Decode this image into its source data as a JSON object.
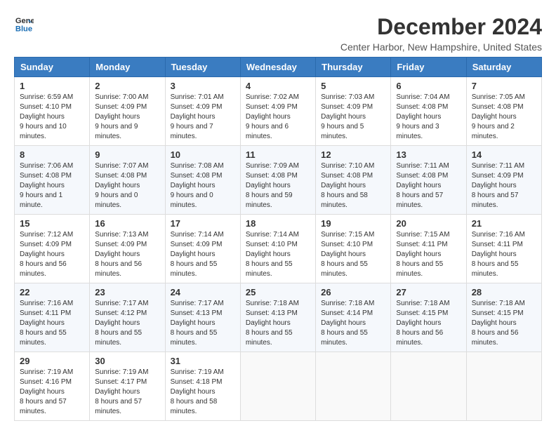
{
  "logo": {
    "line1": "General",
    "line2": "Blue"
  },
  "title": "December 2024",
  "subtitle": "Center Harbor, New Hampshire, United States",
  "days": [
    "Sunday",
    "Monday",
    "Tuesday",
    "Wednesday",
    "Thursday",
    "Friday",
    "Saturday"
  ],
  "weeks": [
    [
      {
        "day": 1,
        "sunrise": "6:59 AM",
        "sunset": "4:10 PM",
        "daylight": "9 hours and 10 minutes."
      },
      {
        "day": 2,
        "sunrise": "7:00 AM",
        "sunset": "4:09 PM",
        "daylight": "9 hours and 9 minutes."
      },
      {
        "day": 3,
        "sunrise": "7:01 AM",
        "sunset": "4:09 PM",
        "daylight": "9 hours and 7 minutes."
      },
      {
        "day": 4,
        "sunrise": "7:02 AM",
        "sunset": "4:09 PM",
        "daylight": "9 hours and 6 minutes."
      },
      {
        "day": 5,
        "sunrise": "7:03 AM",
        "sunset": "4:09 PM",
        "daylight": "9 hours and 5 minutes."
      },
      {
        "day": 6,
        "sunrise": "7:04 AM",
        "sunset": "4:08 PM",
        "daylight": "9 hours and 3 minutes."
      },
      {
        "day": 7,
        "sunrise": "7:05 AM",
        "sunset": "4:08 PM",
        "daylight": "9 hours and 2 minutes."
      }
    ],
    [
      {
        "day": 8,
        "sunrise": "7:06 AM",
        "sunset": "4:08 PM",
        "daylight": "9 hours and 1 minute."
      },
      {
        "day": 9,
        "sunrise": "7:07 AM",
        "sunset": "4:08 PM",
        "daylight": "9 hours and 0 minutes."
      },
      {
        "day": 10,
        "sunrise": "7:08 AM",
        "sunset": "4:08 PM",
        "daylight": "9 hours and 0 minutes."
      },
      {
        "day": 11,
        "sunrise": "7:09 AM",
        "sunset": "4:08 PM",
        "daylight": "8 hours and 59 minutes."
      },
      {
        "day": 12,
        "sunrise": "7:10 AM",
        "sunset": "4:08 PM",
        "daylight": "8 hours and 58 minutes."
      },
      {
        "day": 13,
        "sunrise": "7:11 AM",
        "sunset": "4:08 PM",
        "daylight": "8 hours and 57 minutes."
      },
      {
        "day": 14,
        "sunrise": "7:11 AM",
        "sunset": "4:09 PM",
        "daylight": "8 hours and 57 minutes."
      }
    ],
    [
      {
        "day": 15,
        "sunrise": "7:12 AM",
        "sunset": "4:09 PM",
        "daylight": "8 hours and 56 minutes."
      },
      {
        "day": 16,
        "sunrise": "7:13 AM",
        "sunset": "4:09 PM",
        "daylight": "8 hours and 56 minutes."
      },
      {
        "day": 17,
        "sunrise": "7:14 AM",
        "sunset": "4:09 PM",
        "daylight": "8 hours and 55 minutes."
      },
      {
        "day": 18,
        "sunrise": "7:14 AM",
        "sunset": "4:10 PM",
        "daylight": "8 hours and 55 minutes."
      },
      {
        "day": 19,
        "sunrise": "7:15 AM",
        "sunset": "4:10 PM",
        "daylight": "8 hours and 55 minutes."
      },
      {
        "day": 20,
        "sunrise": "7:15 AM",
        "sunset": "4:11 PM",
        "daylight": "8 hours and 55 minutes."
      },
      {
        "day": 21,
        "sunrise": "7:16 AM",
        "sunset": "4:11 PM",
        "daylight": "8 hours and 55 minutes."
      }
    ],
    [
      {
        "day": 22,
        "sunrise": "7:16 AM",
        "sunset": "4:11 PM",
        "daylight": "8 hours and 55 minutes."
      },
      {
        "day": 23,
        "sunrise": "7:17 AM",
        "sunset": "4:12 PM",
        "daylight": "8 hours and 55 minutes."
      },
      {
        "day": 24,
        "sunrise": "7:17 AM",
        "sunset": "4:13 PM",
        "daylight": "8 hours and 55 minutes."
      },
      {
        "day": 25,
        "sunrise": "7:18 AM",
        "sunset": "4:13 PM",
        "daylight": "8 hours and 55 minutes."
      },
      {
        "day": 26,
        "sunrise": "7:18 AM",
        "sunset": "4:14 PM",
        "daylight": "8 hours and 55 minutes."
      },
      {
        "day": 27,
        "sunrise": "7:18 AM",
        "sunset": "4:15 PM",
        "daylight": "8 hours and 56 minutes."
      },
      {
        "day": 28,
        "sunrise": "7:18 AM",
        "sunset": "4:15 PM",
        "daylight": "8 hours and 56 minutes."
      }
    ],
    [
      {
        "day": 29,
        "sunrise": "7:19 AM",
        "sunset": "4:16 PM",
        "daylight": "8 hours and 57 minutes."
      },
      {
        "day": 30,
        "sunrise": "7:19 AM",
        "sunset": "4:17 PM",
        "daylight": "8 hours and 57 minutes."
      },
      {
        "day": 31,
        "sunrise": "7:19 AM",
        "sunset": "4:18 PM",
        "daylight": "8 hours and 58 minutes."
      },
      null,
      null,
      null,
      null
    ]
  ]
}
